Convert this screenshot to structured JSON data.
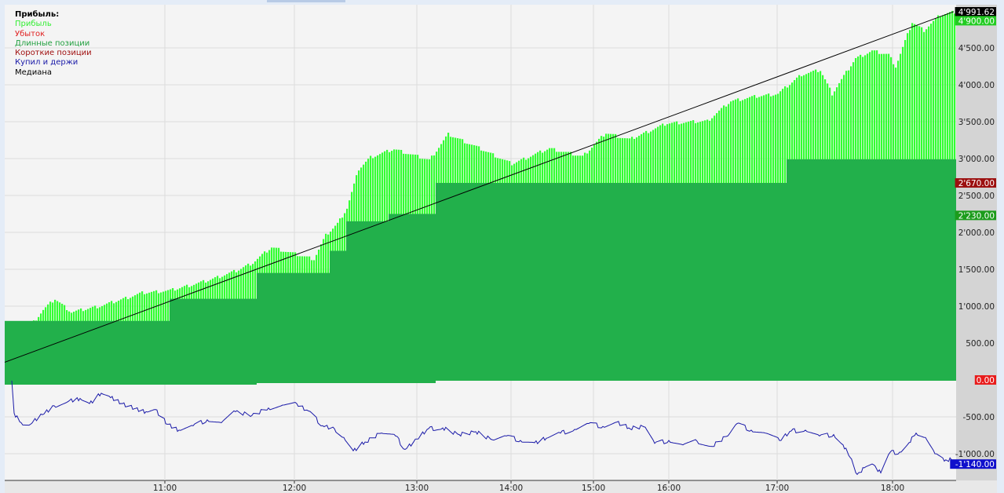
{
  "chart_data": {
    "type": "bar",
    "title": "Прибыль:",
    "legend": [
      {
        "name": "Прибыль",
        "color": "#33ff33"
      },
      {
        "name": "Убыток",
        "color": "#e02020"
      },
      {
        "name": "Длинные позиции",
        "color": "#22b04b"
      },
      {
        "name": "Короткие позиции",
        "color": "#a01010"
      },
      {
        "name": "Купил и держи",
        "color": "#1a1aa8"
      },
      {
        "name": "Медиана",
        "color": "#000000"
      }
    ],
    "legend_position": "top-left",
    "x_index_range": [
      0,
      404
    ],
    "x_ticks": [
      {
        "index": 68,
        "label": "11:00"
      },
      {
        "index": 123,
        "label": "12:00"
      },
      {
        "index": 175,
        "label": "13:00"
      },
      {
        "index": 215,
        "label": "14:00"
      },
      {
        "index": 250,
        "label": "15:00"
      },
      {
        "index": 282,
        "label": "16:00"
      },
      {
        "index": 328,
        "label": "17:00"
      },
      {
        "index": 377,
        "label": "18:00"
      }
    ],
    "ylim": [
      -1350,
      5150
    ],
    "y_ticks": [
      {
        "value": 4500,
        "label": "4'500.00"
      },
      {
        "value": 4000,
        "label": "4'000.00"
      },
      {
        "value": 3500,
        "label": "3'500.00"
      },
      {
        "value": 3000,
        "label": "3'000.00"
      },
      {
        "value": 2500,
        "label": "2'500.00"
      },
      {
        "value": 2000,
        "label": "2'000.00"
      },
      {
        "value": 1500,
        "label": "1'500.00"
      },
      {
        "value": 1000,
        "label": "1'000.00"
      },
      {
        "value": 500,
        "label": "500.00"
      },
      {
        "value": -500,
        "label": "-500.00"
      },
      {
        "value": -1000,
        "label": "-1'000.00"
      }
    ],
    "markers": [
      {
        "value": 4991.62,
        "label": "4'991.62",
        "bg": "#000000",
        "fg": "#ffffff"
      },
      {
        "value": 4900,
        "label": "4'900.00",
        "bg": "#22cc22",
        "fg": "#ffffff"
      },
      {
        "value": 2670,
        "label": "2'670.00",
        "bg": "#9c1010",
        "fg": "#ffffff"
      },
      {
        "value": 2230,
        "label": "2'230.00",
        "bg": "#1c9c1c",
        "fg": "#ffffff"
      },
      {
        "value": 0,
        "label": "0.00",
        "bg": "#e81c1c",
        "fg": "#ffffff"
      },
      {
        "value": -1140,
        "label": "-1'140.00",
        "bg": "#1010cc",
        "fg": "#ffffff"
      }
    ],
    "profit_series": [
      [
        11,
        0
      ],
      [
        11,
        750
      ],
      [
        16,
        950
      ],
      [
        21,
        1100
      ],
      [
        28,
        920
      ],
      [
        41,
        1010
      ],
      [
        58,
        1180
      ],
      [
        70,
        1215
      ],
      [
        85,
        1340
      ],
      [
        98,
        1480
      ],
      [
        105,
        1590
      ],
      [
        113,
        1800
      ],
      [
        125,
        1690
      ],
      [
        131,
        1640
      ],
      [
        136,
        1960
      ],
      [
        141,
        2120
      ],
      [
        145,
        2330
      ],
      [
        150,
        2860
      ],
      [
        155,
        3020
      ],
      [
        165,
        3130
      ],
      [
        171,
        3070
      ],
      [
        180,
        2980
      ],
      [
        188,
        3330
      ],
      [
        198,
        3190
      ],
      [
        208,
        3040
      ],
      [
        215,
        2930
      ],
      [
        231,
        3140
      ],
      [
        245,
        3030
      ],
      [
        255,
        3350
      ],
      [
        265,
        3260
      ],
      [
        281,
        3480
      ],
      [
        298,
        3510
      ],
      [
        308,
        3780
      ],
      [
        318,
        3840
      ],
      [
        328,
        3880
      ],
      [
        338,
        4140
      ],
      [
        346,
        4200
      ],
      [
        351,
        3880
      ],
      [
        361,
        4360
      ],
      [
        368,
        4460
      ],
      [
        375,
        4410
      ],
      [
        378,
        4250
      ],
      [
        385,
        4850
      ],
      [
        390,
        4740
      ],
      [
        397,
        4950
      ],
      [
        403,
        4990
      ]
    ],
    "long_positions_steps": [
      [
        0,
        800
      ],
      [
        70,
        1100
      ],
      [
        107,
        1450
      ],
      [
        138,
        1750
      ],
      [
        145,
        2150
      ],
      [
        163,
        2250
      ],
      [
        183,
        2670
      ],
      [
        332,
        2990
      ],
      [
        404,
        2990
      ]
    ],
    "buy_and_hold": [
      [
        3,
        -10
      ],
      [
        4,
        -450
      ],
      [
        7,
        -580
      ],
      [
        11,
        -600
      ],
      [
        16,
        -470
      ],
      [
        21,
        -350
      ],
      [
        27,
        -290
      ],
      [
        32,
        -250
      ],
      [
        36,
        -320
      ],
      [
        41,
        -180
      ],
      [
        45,
        -240
      ],
      [
        50,
        -320
      ],
      [
        55,
        -390
      ],
      [
        60,
        -430
      ],
      [
        64,
        -400
      ],
      [
        69,
        -600
      ],
      [
        74,
        -680
      ],
      [
        80,
        -620
      ],
      [
        86,
        -540
      ],
      [
        92,
        -580
      ],
      [
        98,
        -430
      ],
      [
        105,
        -480
      ],
      [
        112,
        -380
      ],
      [
        118,
        -340
      ],
      [
        124,
        -320
      ],
      [
        129,
        -420
      ],
      [
        135,
        -620
      ],
      [
        140,
        -660
      ],
      [
        144,
        -780
      ],
      [
        148,
        -960
      ],
      [
        153,
        -840
      ],
      [
        160,
        -720
      ],
      [
        166,
        -760
      ],
      [
        170,
        -940
      ],
      [
        175,
        -800
      ],
      [
        180,
        -660
      ],
      [
        186,
        -650
      ],
      [
        193,
        -740
      ],
      [
        200,
        -700
      ],
      [
        207,
        -810
      ],
      [
        213,
        -760
      ],
      [
        219,
        -820
      ],
      [
        225,
        -850
      ],
      [
        230,
        -790
      ],
      [
        236,
        -720
      ],
      [
        242,
        -670
      ],
      [
        248,
        -590
      ],
      [
        254,
        -630
      ],
      [
        260,
        -570
      ],
      [
        265,
        -650
      ],
      [
        272,
        -640
      ],
      [
        276,
        -860
      ],
      [
        282,
        -820
      ],
      [
        288,
        -880
      ],
      [
        294,
        -830
      ],
      [
        300,
        -900
      ],
      [
        307,
        -760
      ],
      [
        311,
        -590
      ],
      [
        317,
        -680
      ],
      [
        323,
        -720
      ],
      [
        329,
        -820
      ],
      [
        334,
        -690
      ],
      [
        340,
        -680
      ],
      [
        346,
        -760
      ],
      [
        352,
        -740
      ],
      [
        356,
        -880
      ],
      [
        359,
        -1050
      ],
      [
        362,
        -1280
      ],
      [
        365,
        -1190
      ],
      [
        369,
        -1150
      ],
      [
        372,
        -1260
      ],
      [
        376,
        -980
      ],
      [
        380,
        -980
      ],
      [
        384,
        -850
      ],
      [
        387,
        -720
      ],
      [
        391,
        -780
      ],
      [
        395,
        -1000
      ],
      [
        399,
        -1100
      ],
      [
        402,
        -1080
      ],
      [
        403,
        -1140
      ]
    ],
    "median_line": [
      [
        0,
        240
      ],
      [
        403,
        4991.62
      ]
    ]
  }
}
